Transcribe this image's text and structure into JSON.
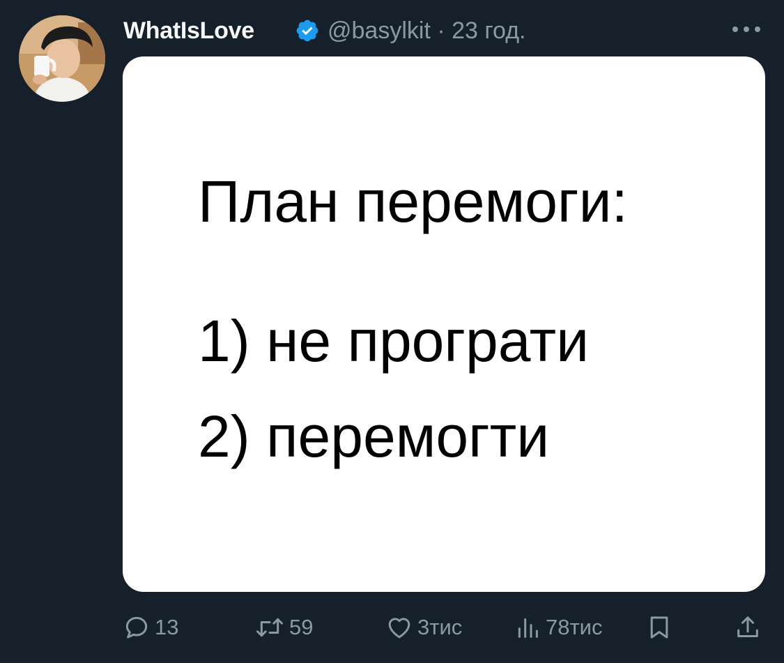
{
  "author": {
    "display_name": "WhatIsLove",
    "handle": "@basylkit",
    "separator": "·",
    "time": "23 год.",
    "verified": true
  },
  "media": {
    "title": "План перемоги:",
    "line1": "1) не програти",
    "line2": "2) перемогти"
  },
  "actions": {
    "replies": "13",
    "reposts": "59",
    "likes": "3тис",
    "views": "78тис"
  },
  "colors": {
    "background": "#15202b",
    "primary_text": "#f7f9f9",
    "secondary_text": "#8b98a5",
    "verified": "#1d9bf0"
  },
  "icons": [
    "verified-icon",
    "more-icon",
    "reply-icon",
    "repost-icon",
    "like-icon",
    "views-icon",
    "bookmark-icon",
    "share-icon"
  ]
}
